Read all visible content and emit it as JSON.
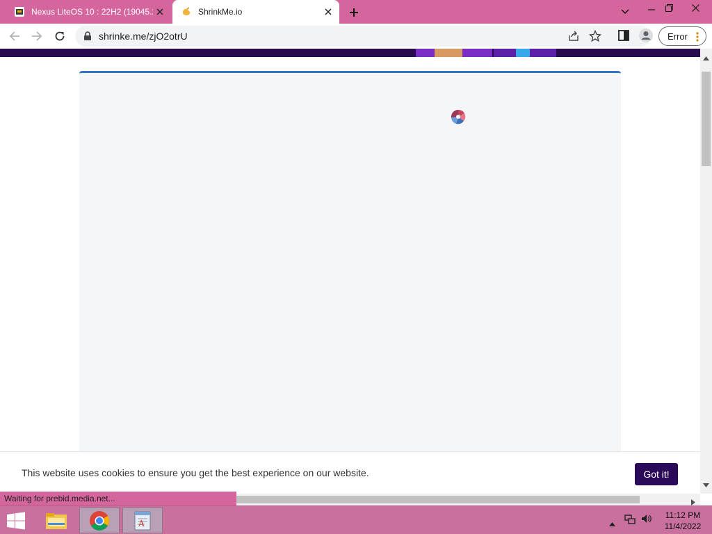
{
  "browser": {
    "tabs": [
      {
        "title": "Nexus LiteOS 10 : 22H2 (19045.2",
        "favicon": "liteos-icon",
        "active": false
      },
      {
        "title": "ShrinkMe.io",
        "favicon": "hand-icon",
        "active": true
      }
    ],
    "url": "shrinke.me/zjO2otrU",
    "profile_button_label": "Error",
    "status_text": "Waiting for prebid.media.net..."
  },
  "page": {
    "cookie_text": "This website uses cookies to ensure you get the best experience on our website.",
    "cookie_button": "Got it!"
  },
  "taskbar": {
    "apps": [
      "start-icon",
      "file-explorer-icon",
      "chrome-icon",
      "notepad-icon"
    ],
    "time": "11:12 PM",
    "date": "11/4/2022"
  },
  "colors": {
    "accent_pink": "#d5659d",
    "cookie_button": "#2c0a5a",
    "content_border": "#3177c6"
  }
}
